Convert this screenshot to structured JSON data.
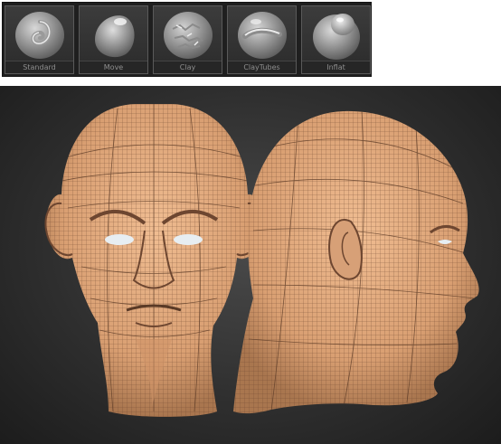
{
  "brush_palette": {
    "brushes": [
      {
        "label": "Standard",
        "icon": "standard-brush-icon"
      },
      {
        "label": "Move",
        "icon": "move-brush-icon"
      },
      {
        "label": "Clay",
        "icon": "clay-brush-icon"
      },
      {
        "label": "ClayTubes",
        "icon": "claytubes-brush-icon"
      },
      {
        "label": "Inflat",
        "icon": "inflat-brush-icon"
      }
    ]
  },
  "viewport": {
    "subject": "sculpted-head-wireframe",
    "views": [
      "front-view",
      "side-view"
    ],
    "colors": {
      "skin": "#e3a97c",
      "wire": "#5a3a26",
      "background": "#2a2a2a"
    }
  }
}
